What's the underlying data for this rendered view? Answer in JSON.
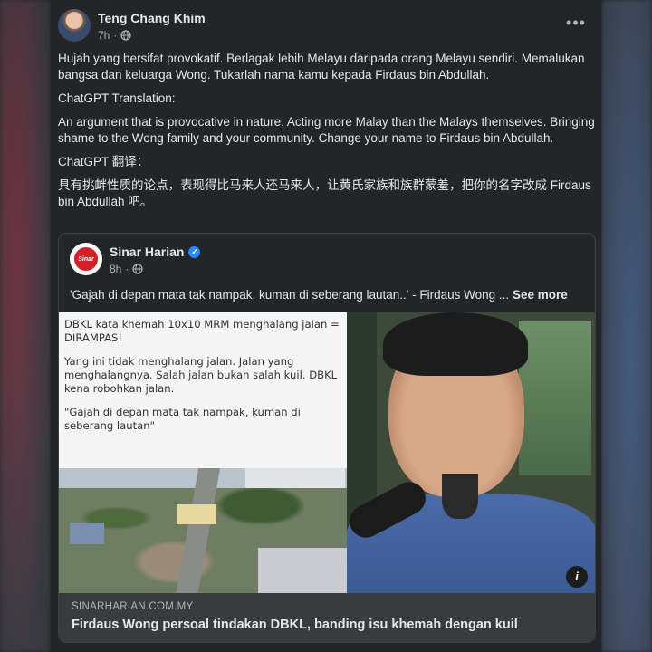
{
  "post": {
    "author": "Teng Chang Khim",
    "time": "7h",
    "paragraphs": [
      "Hujah yang bersifat provokatif. Berlagak lebih Melayu daripada orang Melayu sendiri. Memalukan bangsa dan keluarga Wong. Tukarlah nama kamu kepada Firdaus bin Abdullah.",
      "ChatGPT Translation:",
      "An argument that is provocative in nature. Acting more Malay than the Malays themselves. Bringing shame to the Wong family and your community. Change your name to Firdaus bin Abdullah.",
      "ChatGPT 翻译：",
      "具有挑衅性质的论点，表现得比马来人还马来人，让黄氏家族和族群蒙羞，把你的名字改成 Firdaus bin Abdullah 吧。"
    ]
  },
  "shared": {
    "page_name": "Sinar Harian",
    "logo_text": "Sinar",
    "time": "8h",
    "caption": "'Gajah di depan mata tak nampak, kuman di seberang lautan..' - Firdaus Wong ...",
    "see_more": "See more",
    "image_quote": [
      "DBKL kata khemah 10x10 MRM menghalang jalan = DIRAMPAS!",
      "Yang ini tidak menghalang jalan. Jalan yang menghalangnya. Salah jalan bukan salah kuil. DBKL kena robohkan jalan.",
      "\"Gajah di depan mata tak nampak, kuman di seberang lautan\""
    ],
    "info_label": "i",
    "domain": "SINARHARIAN.COM.MY",
    "title": "Firdaus Wong persoal tindakan DBKL, banding isu khemah dengan kuil"
  },
  "more_label": "•••",
  "verified_glyph": "✓"
}
